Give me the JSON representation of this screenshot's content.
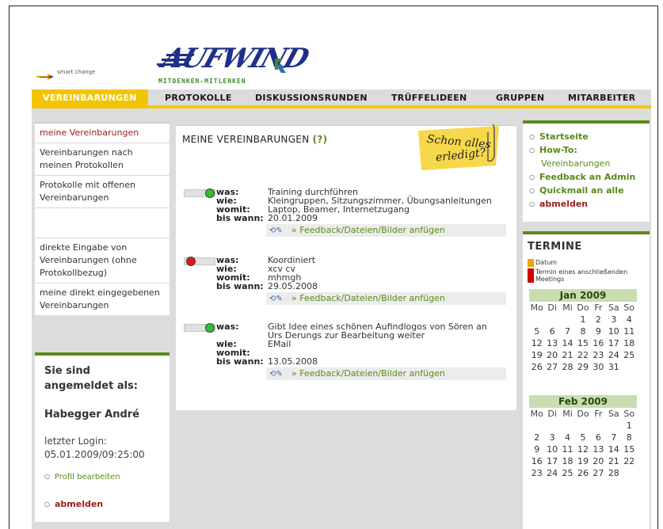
{
  "header": {
    "brand_small": "smart change",
    "brand_main": "AUFWIND",
    "tagline": "MITDENKEN-MITLENKEN"
  },
  "nav": [
    {
      "label": "VEREINBARUNGEN",
      "active": true
    },
    {
      "label": "PROTOKOLLE"
    },
    {
      "label": "DISKUSSIONSRUNDEN"
    },
    {
      "label": "TRÜFFELIDEEN"
    },
    {
      "label": "GRUPPEN"
    },
    {
      "label": "MITARBEITER"
    }
  ],
  "left_menu": [
    "meine Vereinbarungen",
    "Vereinbarungen nach meinen Protokollen",
    "Protokolle mit offenen Vereinbarungen",
    "direkte Eingabe von Vereinbarungen (ohne Protokollbezug)",
    "meine direkt eingegebenen Vereinbarungen"
  ],
  "login": {
    "title": "Sie sind angemeldet als:",
    "name": "Habegger André",
    "last_login_label": "letzter Login:",
    "last_login_value": "05.01.2009/09:25:00",
    "profile_link": "Profil bearbeiten",
    "logout": "abmelden"
  },
  "main": {
    "title": "MEINE VEREINBARUNGEN",
    "help": "(?)",
    "sticky_text": "Schon alles erledigt?",
    "labels": {
      "was": "was:",
      "wie": "wie:",
      "womit": "womit:",
      "bis_wann": "bis wann:"
    },
    "feedback_label": "» Feedback/Dateien/Bilder anfügen",
    "entries": [
      {
        "status": "green",
        "was": "Training durchführen",
        "wie": "Kleingruppen, Sitzungszimmer, Übungsanleitungen",
        "womit": "Laptop, Beamer, Internetzugang",
        "bis_wann": "20.01.2009"
      },
      {
        "status": "red",
        "was": "Koordiniert",
        "wie": "xcv cv",
        "womit": "mhmgh",
        "bis_wann": "29.05.2008"
      },
      {
        "status": "green",
        "was": "Gibt Idee eines schönen Aufindlogos von Sören an Urs Derungs zur Bearbeitung weiter",
        "wie": "EMail",
        "womit": "",
        "bis_wann": "13.05.2008"
      }
    ]
  },
  "right_links": {
    "startseite": "Startseite",
    "howto": "How-To:",
    "howto_sub": "Vereinbarungen",
    "feedback": "Feedback an Admin",
    "quickmail": "Quickmail an alle",
    "logout": "abmelden"
  },
  "termine": {
    "title": "TERMINE",
    "legend_datum": "Datum",
    "legend_meeting": "Termin eines anschließenden Meetings",
    "colors": {
      "datum": "#f2a100",
      "meeting": "#cc0000"
    },
    "dow": [
      "Mo",
      "Di",
      "Mi",
      "Do",
      "Fr",
      "Sa",
      "So"
    ],
    "jan": {
      "title": "Jan 2009",
      "weeks": [
        [
          "",
          "",
          "",
          "1",
          "2",
          "3",
          "4"
        ],
        [
          "5",
          "6",
          "7",
          "8",
          "9",
          "10",
          "11"
        ],
        [
          "12",
          "13",
          "14",
          "15",
          "16",
          "17",
          "18"
        ],
        [
          "19",
          "20",
          "21",
          "22",
          "23",
          "24",
          "25"
        ],
        [
          "26",
          "27",
          "28",
          "29",
          "30",
          "31",
          ""
        ]
      ]
    },
    "feb": {
      "title": "Feb 2009",
      "weeks": [
        [
          "",
          "",
          "",
          "",
          "",
          "",
          "1"
        ],
        [
          "2",
          "3",
          "4",
          "5",
          "6",
          "7",
          "8"
        ],
        [
          "9",
          "10",
          "11",
          "12",
          "13",
          "14",
          "15"
        ],
        [
          "16",
          "17",
          "18",
          "19",
          "20",
          "21",
          "22"
        ],
        [
          "23",
          "24",
          "25",
          "26",
          "27",
          "28",
          ""
        ]
      ]
    }
  }
}
